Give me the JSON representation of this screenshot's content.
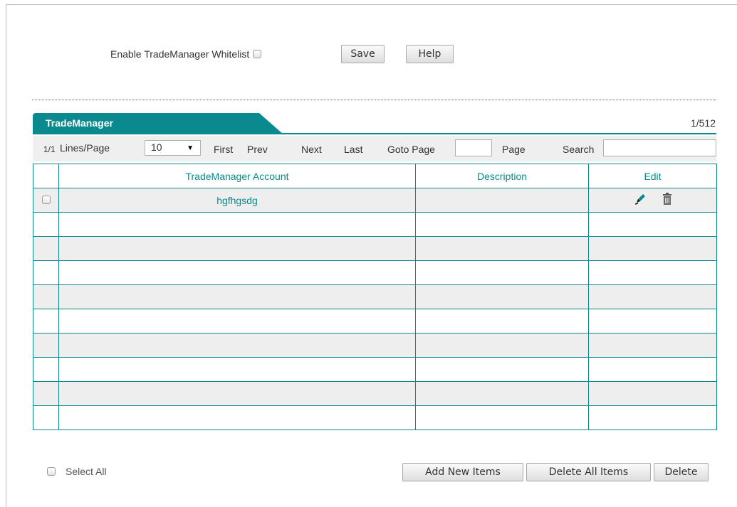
{
  "whitelist": {
    "label": "Enable TradeManager Whitelist",
    "checked": false,
    "save_label": "Save",
    "help_label": "Help"
  },
  "panel": {
    "tab_label": "TradeManager",
    "count": "1/512"
  },
  "nav": {
    "page_indicator": "1/1",
    "lines_label": "Lines/Page",
    "lines_value": "10",
    "first": "First",
    "prev": "Prev",
    "next": "Next",
    "last": "Last",
    "goto_label": "Goto Page",
    "page_label": "Page",
    "search_label": "Search",
    "goto_value": "",
    "search_value": ""
  },
  "table": {
    "headers": [
      "",
      "TradeManager Account",
      "Description",
      "Edit"
    ],
    "rows": [
      {
        "account": "hgfhgsdg",
        "description": ""
      }
    ],
    "empty_rows": 9
  },
  "footer": {
    "select_all": "Select All",
    "add_new": "Add New Items",
    "delete_all": "Delete All Items",
    "delete": "Delete"
  },
  "colors": {
    "accent": "#0a8a8e",
    "row_stripe": "#eeeeee"
  }
}
